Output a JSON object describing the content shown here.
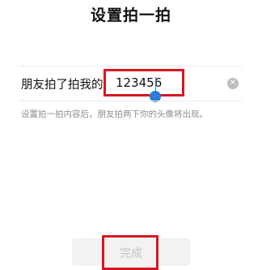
{
  "page": {
    "title": "设置拍一拍"
  },
  "form": {
    "label": "朋友拍了拍我的",
    "value": "123456",
    "clear_icon": "clear-circle-icon",
    "hint": "设置拍一拍内容后，朋友拍两下你的头像将出现。"
  },
  "footer": {
    "done_label": "完成"
  },
  "colors": {
    "highlight": "#d9161f",
    "caret": "#2b7fd6",
    "disabled_button_bg": "#f2f2f2",
    "disabled_text": "#c3c3c3"
  }
}
